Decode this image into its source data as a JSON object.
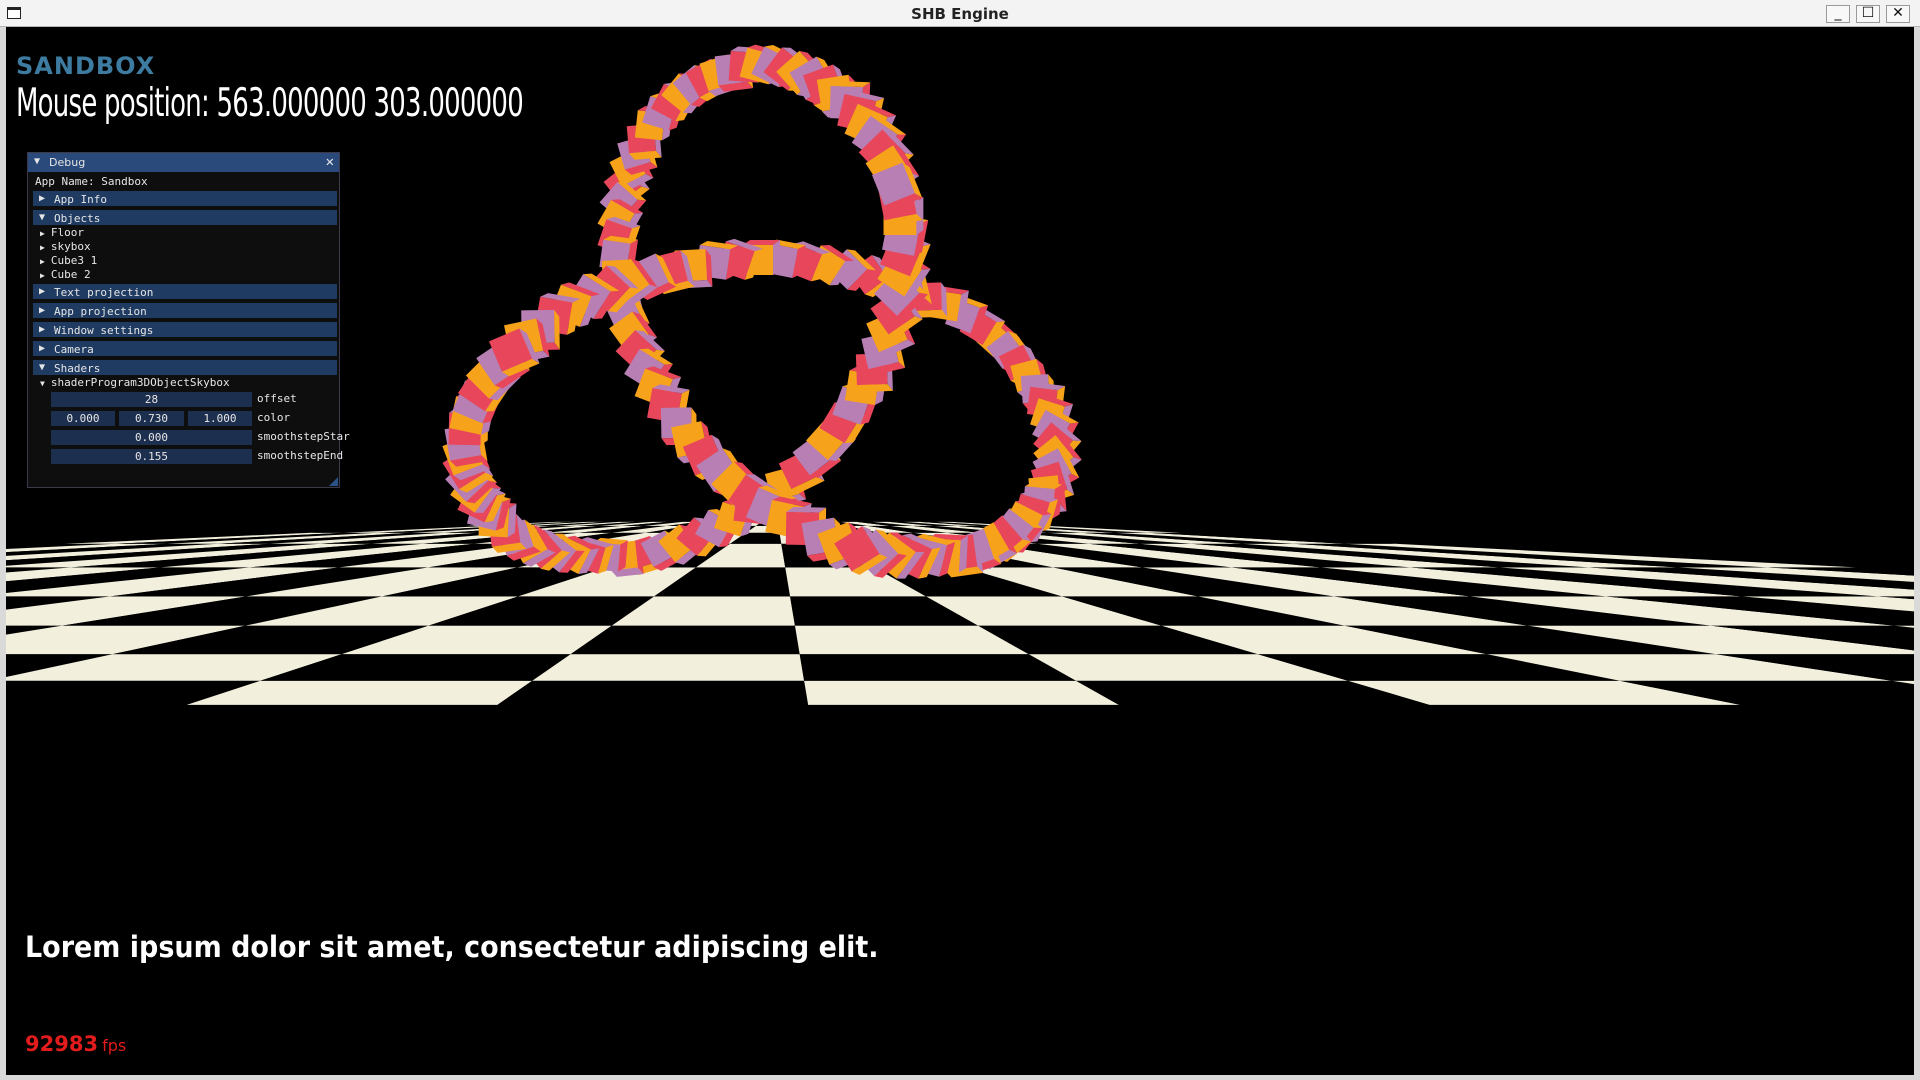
{
  "window": {
    "title": "SHB Engine",
    "controls": {
      "minimize": "_",
      "maximize": "☐",
      "close": "✕"
    }
  },
  "overlay": {
    "app_name": "Sandbox",
    "mouse_position_label": "Mouse position:",
    "mouse_x": "563.000000",
    "mouse_y": "303.000000",
    "lorem_text": "Lorem ipsum dolor sit amet, consectetur adipiscing elit.",
    "fps_value": "92983",
    "fps_unit": "fps"
  },
  "colors": {
    "app_name": "#3d7ca0",
    "fps": "#e21c1c",
    "imgui_title": "#294a7a",
    "imgui_header": "#1f3b62",
    "floor_light": "#f2efdc",
    "floor_dark": "#000000",
    "knot_a": "#f7a21b",
    "knot_b": "#b77fb4",
    "knot_c": "#e7465b"
  },
  "debug_panel": {
    "title": "Debug",
    "app_name_line": "App Name: Sandbox",
    "sections": {
      "app_info": "App Info",
      "objects": "Objects",
      "text_projection": "Text projection",
      "app_projection": "App projection",
      "window_settings": "Window settings",
      "camera": "Camera",
      "shaders": "Shaders"
    },
    "objects": [
      "Floor",
      "skybox",
      "Cube3 1",
      "Cube 2"
    ],
    "shader_program": "shaderProgram3DObjectSkybox",
    "fields": {
      "offset": {
        "label": "offset",
        "value": "28"
      },
      "color": {
        "label": "color",
        "values": [
          "0.000",
          "0.730",
          "1.000"
        ]
      },
      "smoothstep_start": {
        "label": "smoothstepStar",
        "value": "0.000"
      },
      "smoothstep_end": {
        "label": "smoothstepEnd",
        "value": "0.155"
      }
    }
  }
}
